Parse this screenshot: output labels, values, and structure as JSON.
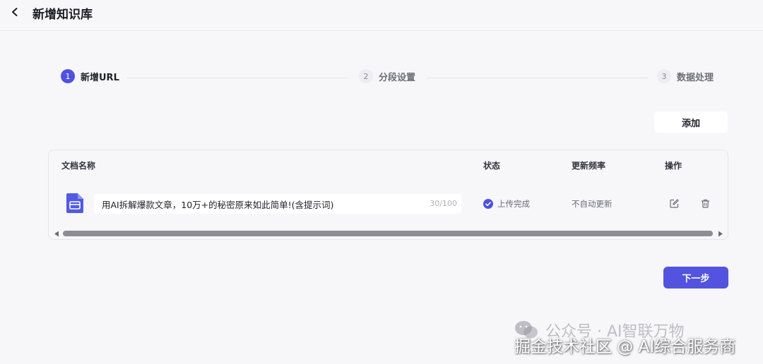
{
  "header": {
    "title": "新增知识库"
  },
  "stepper": {
    "steps": [
      {
        "num": "1",
        "label": "新增URL",
        "state": "active"
      },
      {
        "num": "2",
        "label": "分段设置",
        "state": "pending"
      },
      {
        "num": "3",
        "label": "数据处理",
        "state": "pending"
      }
    ]
  },
  "toolbar": {
    "add_label": "添加"
  },
  "table": {
    "columns": {
      "name": "文档名称",
      "status": "状态",
      "frequency": "更新频率",
      "actions": "操作"
    },
    "rows": [
      {
        "name": "用AI拆解爆款文章，10万+的秘密原来如此简单!(含提示词)",
        "char_count": "30/100",
        "status": "上传完成",
        "frequency": "不自动更新"
      }
    ],
    "scroll_position": 1.0
  },
  "footer": {
    "next_label": "下一步"
  },
  "watermark": {
    "line1": "公众号 · AI智联万物",
    "line2": "掘金技术社区 @ AI综合服务商"
  },
  "colors": {
    "accent": "#5353e0",
    "status_ok": "#4f52e0",
    "background": "#f7f7fa"
  }
}
